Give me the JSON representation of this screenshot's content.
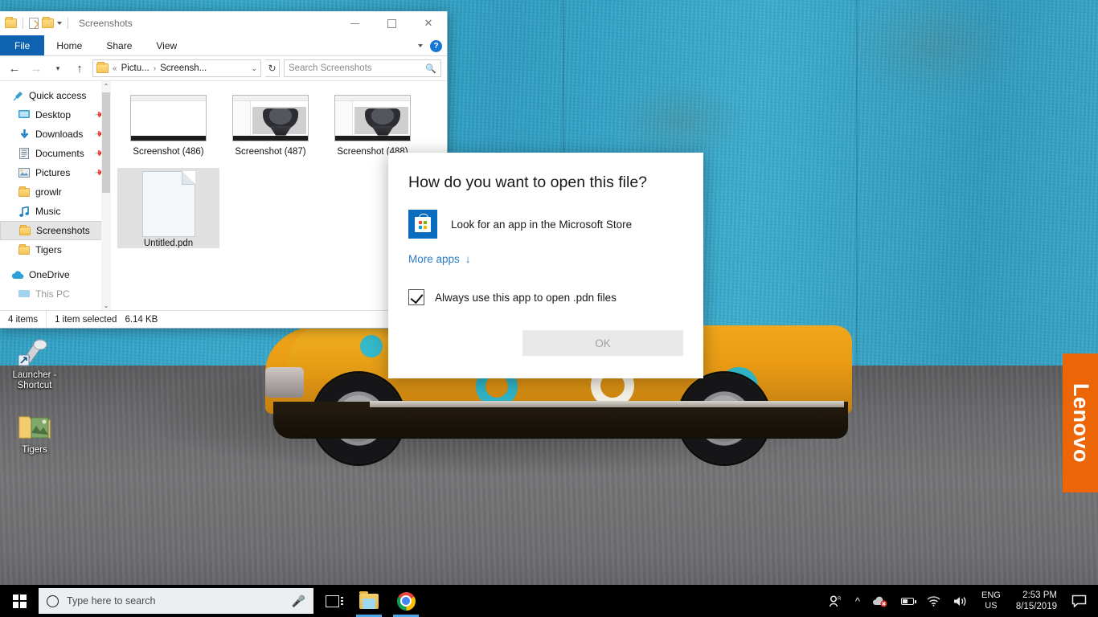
{
  "window": {
    "title": "Screenshots",
    "quick_access_icons": [
      "folder-icon",
      "properties-icon",
      "new-folder-icon",
      "customize-chevron-icon"
    ],
    "controls": {
      "minimize": "minimize-icon",
      "maximize": "maximize-icon",
      "close": "close-icon"
    },
    "ribbon_tabs": [
      {
        "label": "File",
        "active": true
      },
      {
        "label": "Home",
        "active": false
      },
      {
        "label": "Share",
        "active": false
      },
      {
        "label": "View",
        "active": false
      }
    ],
    "ribbon_expand": "chevron-down-icon",
    "help_label": "?",
    "address": {
      "back": "back-arrow-icon",
      "forward": "forward-arrow-icon",
      "recent": "chevron-down-icon",
      "up": "up-arrow-icon",
      "crumb_overflow": "«",
      "crumb1": "Pictu...",
      "crumb_sep": "›",
      "crumb2": "Screensh...",
      "dropdown": "⌄",
      "refresh": "↻"
    },
    "search": {
      "placeholder": "Search Screenshots",
      "icon": "search-icon"
    }
  },
  "sidebar": {
    "items": [
      {
        "label": "Quick access",
        "icon": "pin-icon",
        "pinned": false,
        "selected": false
      },
      {
        "label": "Desktop",
        "icon": "desktop-icon",
        "pinned": true,
        "selected": false
      },
      {
        "label": "Downloads",
        "icon": "downloads-icon",
        "pinned": true,
        "selected": false
      },
      {
        "label": "Documents",
        "icon": "documents-icon",
        "pinned": true,
        "selected": false
      },
      {
        "label": "Pictures",
        "icon": "pictures-icon",
        "pinned": true,
        "selected": false
      },
      {
        "label": "growlr",
        "icon": "folder-icon",
        "pinned": false,
        "selected": false
      },
      {
        "label": "Music",
        "icon": "music-icon",
        "pinned": false,
        "selected": false
      },
      {
        "label": "Screenshots",
        "icon": "folder-icon",
        "pinned": false,
        "selected": true
      },
      {
        "label": "Tigers",
        "icon": "folder-icon",
        "pinned": false,
        "selected": false
      },
      {
        "label": "OneDrive",
        "icon": "cloud-icon",
        "pinned": false,
        "selected": false
      }
    ],
    "scroll_up": "⌃",
    "scroll_down": "⌄"
  },
  "files": [
    {
      "name": "Screenshot (486)",
      "type": "screenshot-blank",
      "selected": false
    },
    {
      "name": "Screenshot (487)",
      "type": "screenshot-grill",
      "selected": false
    },
    {
      "name": "Screenshot (488)",
      "type": "screenshot-grill",
      "selected": false
    },
    {
      "name": "Untitled.pdn",
      "type": "document",
      "selected": true
    }
  ],
  "status": {
    "item_count": "4 items",
    "selection": "1 item selected",
    "size": "6.14 KB"
  },
  "dialog": {
    "title": "How do you want to open this file?",
    "store_option": "Look for an app in the Microsoft Store",
    "store_icon": "microsoft-store-icon",
    "more_apps": "More apps",
    "more_apps_icon": "down-arrow-icon",
    "checkbox_label": "Always use this app to open .pdn files",
    "checkbox_checked": true,
    "ok_label": "OK",
    "ok_enabled": false
  },
  "desktop_icons": [
    {
      "label": "Launcher - Shortcut",
      "icon": "launcher-shortcut-icon"
    },
    {
      "label": "Tigers",
      "icon": "folder-picture-icon"
    }
  ],
  "branding": {
    "lenovo": "Lenovo",
    "lenovo_color": "#ec6608"
  },
  "taskbar": {
    "start_icon": "windows-logo-icon",
    "search_placeholder": "Type here to search",
    "search_circle_icon": "cortana-circle-icon",
    "mic_icon": "microphone-icon",
    "task_view_icon": "task-view-icon",
    "apps": [
      {
        "name": "File Explorer",
        "icon": "file-explorer-icon",
        "active": true
      },
      {
        "name": "Google Chrome",
        "icon": "chrome-icon",
        "active": true
      }
    ],
    "tray": {
      "people_icon": "people-icon",
      "overflow_icon": "show-hidden-icons-chevron",
      "onedrive_icon": "onedrive-error-icon",
      "battery_icon": "battery-icon",
      "wifi_icon": "wifi-icon",
      "volume_icon": "volume-icon",
      "language_line1": "ENG",
      "language_line2": "US",
      "time": "2:53 PM",
      "date": "8/15/2019",
      "action_center_icon": "action-center-icon"
    }
  }
}
